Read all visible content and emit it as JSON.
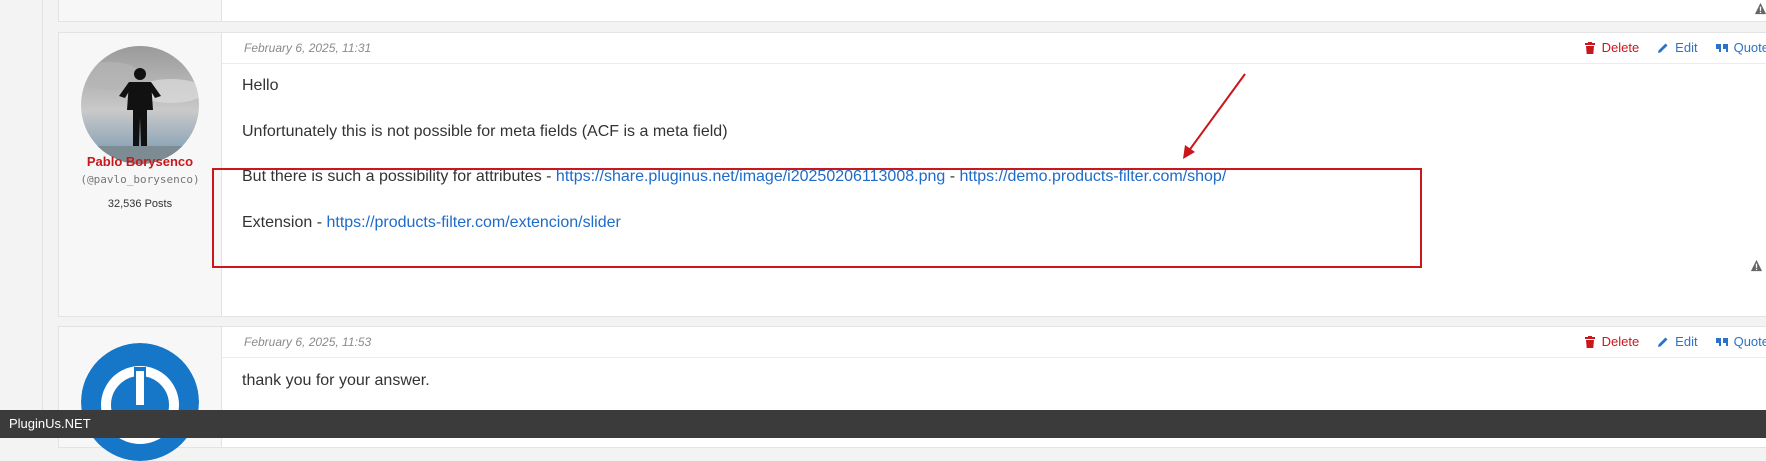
{
  "posts": [
    {
      "date": "February 6, 2025, 11:31",
      "actions": {
        "delete": "Delete",
        "edit": "Edit",
        "quote": "Quote"
      },
      "author": {
        "name": "Pablo Borysenco",
        "handle": "(@pavlo_borysenco)",
        "posts": "32,536 Posts"
      },
      "body": {
        "greeting": "Hello",
        "line1": "Unfortunately this is not possible for meta fields (ACF is a meta field)",
        "line2_prefix": "But there is such a possibility for attributes - ",
        "link1": "https://share.pluginus.net/image/i20250206113008.png",
        "line2_sep": " - ",
        "link2": "https://demo.products-filter.com/shop/",
        "line3_prefix": "Extension - ",
        "link3": "https://products-filter.com/extencion/slider"
      }
    },
    {
      "date": "February 6, 2025, 11:53",
      "actions": {
        "delete": "Delete",
        "edit": "Edit",
        "quote": "Quote"
      },
      "body": {
        "line1": "thank you for your answer."
      }
    }
  ],
  "status_bar": {
    "text": "PluginUs.NET"
  },
  "colors": {
    "accent_red": "#c9171b",
    "link_blue": "#1e6bc9",
    "status_bar_bg": "#3b3b3b"
  },
  "icons": [
    "trash-icon",
    "pencil-icon",
    "quote-icon",
    "warning-icon"
  ]
}
